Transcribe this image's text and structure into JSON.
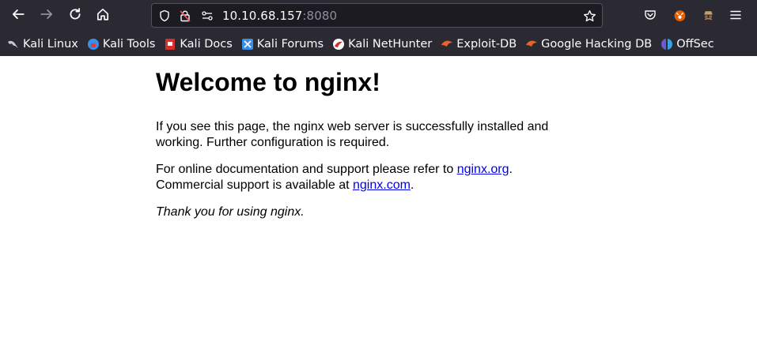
{
  "browser": {
    "url_host": "10.10.68.157",
    "url_port": ":8080",
    "icons": {
      "back": "arrow-left-icon",
      "forward": "arrow-right-icon",
      "reload": "reload-icon",
      "home": "home-icon",
      "shield": "shield-icon",
      "lock": "insecure-lock-icon",
      "permissions": "permissions-icon",
      "bookmark_star": "star-icon",
      "pocket": "pocket-icon",
      "extension_fox": "fox-extension-icon",
      "extension_spy": "spy-extension-icon",
      "menu": "hamburger-menu-icon"
    }
  },
  "bookmarks": [
    {
      "label": "Kali Linux",
      "icon": "kali-dragon-icon"
    },
    {
      "label": "Kali Tools",
      "icon": "kali-tools-icon"
    },
    {
      "label": "Kali Docs",
      "icon": "kali-docs-icon"
    },
    {
      "label": "Kali Forums",
      "icon": "kali-forums-icon"
    },
    {
      "label": "Kali NetHunter",
      "icon": "nethunter-icon"
    },
    {
      "label": "Exploit-DB",
      "icon": "exploit-db-icon"
    },
    {
      "label": "Google Hacking DB",
      "icon": "ghdb-icon"
    },
    {
      "label": "OffSec",
      "icon": "offsec-icon"
    }
  ],
  "page": {
    "heading": "Welcome to nginx!",
    "p1": "If you see this page, the nginx web server is successfully installed and working. Further configuration is required.",
    "p2_before": "For online documentation and support please refer to ",
    "p2_link1": "nginx.org",
    "p2_mid": ".",
    "p2_line2": "Commercial support is available at ",
    "p2_link2": "nginx.com",
    "p2_after": ".",
    "p3": "Thank you for using nginx."
  },
  "colors": {
    "chrome_bg": "#2b2a33",
    "urlbar_bg": "#1c1b22",
    "link": "#0000ee"
  }
}
